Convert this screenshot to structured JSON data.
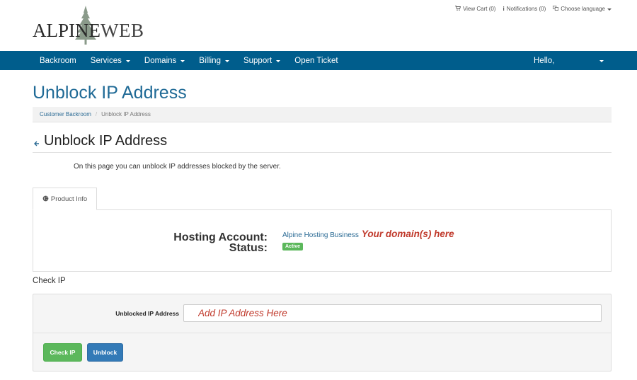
{
  "brand": {
    "logo_left": "ALPINE",
    "logo_right": "WEB",
    "tree_color": "#8a9a8a"
  },
  "toplinks": {
    "cart_icon": "cart-icon",
    "cart": "View Cart (0)",
    "notifications_icon": "info-icon",
    "notifications": "Notifications (0)",
    "language_icon": "language-icon",
    "language": "Choose language"
  },
  "nav": {
    "items": [
      {
        "label": "Backroom",
        "dropdown": false
      },
      {
        "label": "Services",
        "dropdown": true
      },
      {
        "label": "Domains",
        "dropdown": true
      },
      {
        "label": "Billing",
        "dropdown": true
      },
      {
        "label": "Support",
        "dropdown": true
      },
      {
        "label": "Open Ticket",
        "dropdown": false
      }
    ],
    "hello": "Hello,"
  },
  "page": {
    "title": "Unblock IP Address",
    "breadcrumb": {
      "home": "Customer Backroom",
      "separator": "/",
      "current": "Unblock IP Address"
    },
    "sub_title": "Unblock IP Address",
    "back_icon": "arrow-left-icon",
    "intro": "On this page you can unblock IP addresses blocked by the server."
  },
  "product": {
    "tab_label": "Product Info",
    "tab_icon": "globe-icon",
    "hosting_label": "Hosting Account:",
    "hosting_value": "Alpine Hosting Business",
    "domain_note": "Your domain(s) here",
    "status_label": "Status:",
    "status_value": "Active"
  },
  "check_ip": {
    "section_label": "Check IP",
    "field_label": "Unblocked IP Address",
    "input_placeholder": "Add IP Address Here",
    "check_button": "Check IP",
    "unblock_button": "Unblock"
  },
  "colors": {
    "navbar": "#005d8c",
    "title": "#1f6a96",
    "link": "#2a6a94",
    "success": "#5cb85c",
    "primary": "#337ab7",
    "annotation": "#c0392b"
  }
}
